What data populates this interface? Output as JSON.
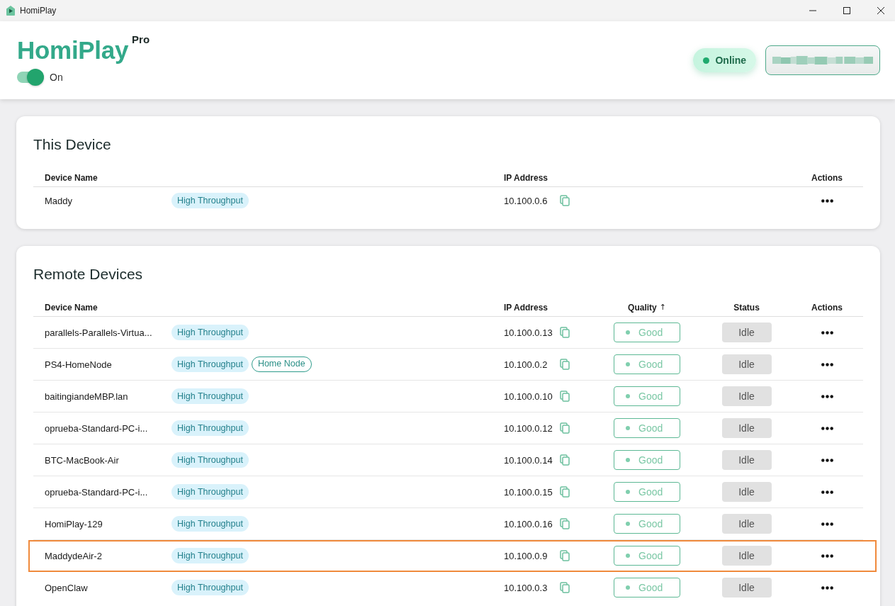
{
  "window": {
    "title": "HomiPlay"
  },
  "header": {
    "logo": "HomiPlay",
    "edition": "Pro",
    "power": {
      "on": true,
      "label": "On"
    },
    "connection": {
      "online": true,
      "label": "Online"
    }
  },
  "sections": [
    {
      "title": "This Device",
      "columns": [
        {
          "label": "Device Name",
          "kind": "name"
        },
        {
          "label": "IP Address",
          "kind": "ip"
        },
        {
          "label": "Actions",
          "kind": "actions"
        }
      ],
      "rows": [
        {
          "name": "Maddy",
          "tags": [
            {
              "label": "High Throughput",
              "kind": "filled"
            }
          ],
          "ip": "10.100.0.6",
          "selected": false
        }
      ]
    },
    {
      "title": "Remote Devices",
      "columns": [
        {
          "label": "Device Name",
          "kind": "name"
        },
        {
          "label": "IP Address",
          "kind": "ip"
        },
        {
          "label": "Quality",
          "kind": "quality",
          "sort_icon": "↑"
        },
        {
          "label": "Status",
          "kind": "status"
        },
        {
          "label": "Actions",
          "kind": "actions"
        }
      ],
      "rows": [
        {
          "name": "parallels-Parallels-Virtua...",
          "tags": [
            {
              "label": "High Throughput",
              "kind": "filled"
            }
          ],
          "ip": "10.100.0.13",
          "quality": "Good",
          "status": "Idle",
          "selected": false
        },
        {
          "name": "PS4-HomeNode",
          "tags": [
            {
              "label": "High Throughput",
              "kind": "filled"
            },
            {
              "label": "Home Node",
              "kind": "outlined"
            }
          ],
          "ip": "10.100.0.2",
          "quality": "Good",
          "status": "Idle",
          "selected": false
        },
        {
          "name": "baitingiandeMBP.lan",
          "tags": [
            {
              "label": "High Throughput",
              "kind": "filled"
            }
          ],
          "ip": "10.100.0.10",
          "quality": "Good",
          "status": "Idle",
          "selected": false
        },
        {
          "name": "oprueba-Standard-PC-i...",
          "tags": [
            {
              "label": "High Throughput",
              "kind": "filled"
            }
          ],
          "ip": "10.100.0.12",
          "quality": "Good",
          "status": "Idle",
          "selected": false
        },
        {
          "name": "BTC-MacBook-Air",
          "tags": [
            {
              "label": "High Throughput",
              "kind": "filled"
            }
          ],
          "ip": "10.100.0.14",
          "quality": "Good",
          "status": "Idle",
          "selected": false
        },
        {
          "name": "oprueba-Standard-PC-i...",
          "tags": [
            {
              "label": "High Throughput",
              "kind": "filled"
            }
          ],
          "ip": "10.100.0.15",
          "quality": "Good",
          "status": "Idle",
          "selected": false
        },
        {
          "name": "HomiPlay-129",
          "tags": [
            {
              "label": "High Throughput",
              "kind": "filled"
            }
          ],
          "ip": "10.100.0.16",
          "quality": "Good",
          "status": "Idle",
          "selected": false
        },
        {
          "name": "MaddydeAir-2",
          "tags": [
            {
              "label": "High Throughput",
              "kind": "filled"
            }
          ],
          "ip": "10.100.0.9",
          "quality": "Good",
          "status": "Idle",
          "selected": true
        },
        {
          "name": "OpenClaw",
          "tags": [
            {
              "label": "High Throughput",
              "kind": "filled"
            }
          ],
          "ip": "10.100.0.3",
          "quality": "Good",
          "status": "Idle",
          "selected": false
        }
      ]
    }
  ]
}
